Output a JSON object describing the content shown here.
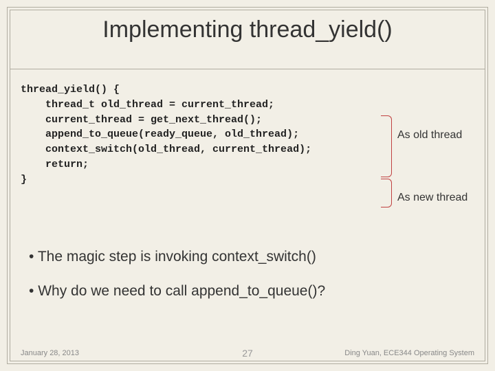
{
  "title": "Implementing thread_yield()",
  "code": {
    "l1": "thread_yield() {",
    "l2": "    thread_t old_thread = current_thread;",
    "l3": "    current_thread = get_next_thread();",
    "l4": "    append_to_queue(ready_queue, old_thread);",
    "l5": "    context_switch(old_thread, current_thread);",
    "l6": "    return;",
    "l7": "}"
  },
  "annotations": {
    "old": "As old thread",
    "new": "As new thread"
  },
  "bullets": {
    "b1": "The magic step is invoking context_switch()",
    "b2": "Why do we need to call append_to_queue()?"
  },
  "footer": {
    "date": "January 28, 2013",
    "page": "27",
    "course": "Ding Yuan, ECE344 Operating System"
  }
}
